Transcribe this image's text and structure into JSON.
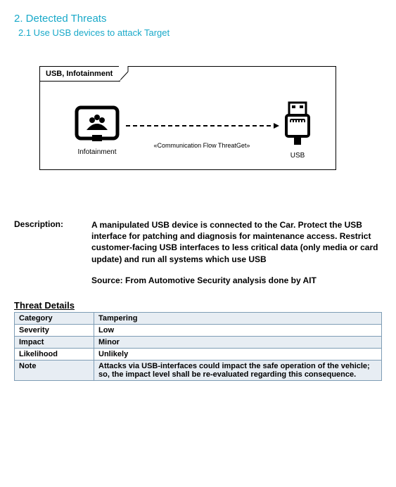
{
  "headings": {
    "section": "2.  Detected Threats",
    "subsection": "2.1 Use USB devices to attack Target"
  },
  "diagram": {
    "tab": "USB, Infotainment",
    "leftLabel": "Infotainment",
    "rightLabel": "USB",
    "flowLabel": "«Communication Flow ThreatGet»"
  },
  "description": {
    "label": "Description:",
    "text": "A manipulated USB device is connected to the Car. Protect the USB interface for patching and diagnosis for maintenance access. Restrict customer-facing USB interfaces to less critical data (only media or card update) and run all systems which use USB",
    "source": "Source: From Automotive Security analysis done by AIT"
  },
  "threatDetails": {
    "heading": "Threat Details",
    "rows": [
      {
        "k": "Category",
        "v": "Tampering"
      },
      {
        "k": "Severity",
        "v": "Low"
      },
      {
        "k": "Impact",
        "v": "Minor"
      },
      {
        "k": "Likelihood",
        "v": "Unlikely"
      },
      {
        "k": "Note",
        "v": "Attacks via USB-interfaces could impact the safe operation of the vehicle; so, the impact level shall be re-evaluated regarding this consequence."
      }
    ]
  }
}
